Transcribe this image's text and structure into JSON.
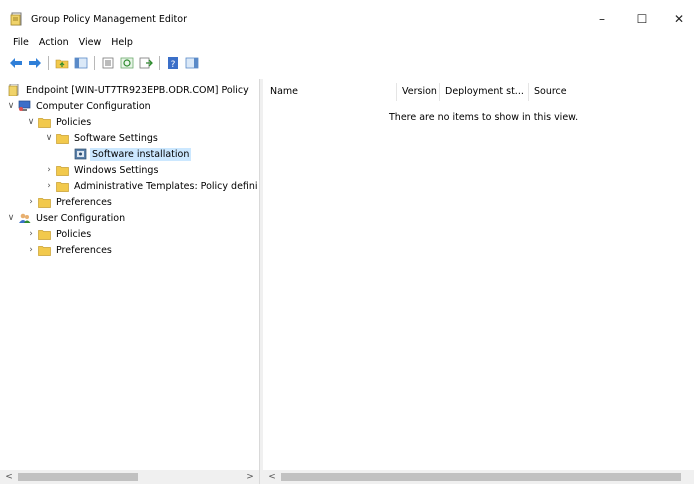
{
  "window": {
    "title": "Group Policy Management Editor",
    "minimize_icon": "–",
    "maximize_icon": "☐",
    "close_icon": "✕"
  },
  "menu": [
    "File",
    "Action",
    "View",
    "Help"
  ],
  "toolbar": {
    "icons": [
      "back-arrow-icon",
      "forward-arrow-icon",
      "up-folder-icon",
      "show-hide-tree-icon",
      "properties-icon",
      "refresh-icon",
      "export-list-icon",
      "help-icon",
      "show-action-pane-icon"
    ]
  },
  "tree": {
    "root": "Endpoint [WIN-UT7TR923EPB.ODR.COM] Policy",
    "computer_configuration": "Computer Configuration",
    "policies": "Policies",
    "software_settings": "Software Settings",
    "software_installation": "Software installation",
    "windows_settings": "Windows Settings",
    "administrative_templates": "Administrative Templates: Policy defini",
    "preferences": "Preferences",
    "user_configuration": "User Configuration",
    "user_policies": "Policies",
    "user_preferences": "Preferences"
  },
  "list": {
    "columns": [
      "Name",
      "Version",
      "Deployment st...",
      "Source"
    ],
    "empty_message": "There are no items to show in this view."
  },
  "scroll": {
    "left_arrow": "<",
    "right_arrow": ">"
  },
  "colors": {
    "selection": "#cce8ff",
    "folder": "#f2c94c",
    "arrow_blue": "#2f7fd8"
  }
}
